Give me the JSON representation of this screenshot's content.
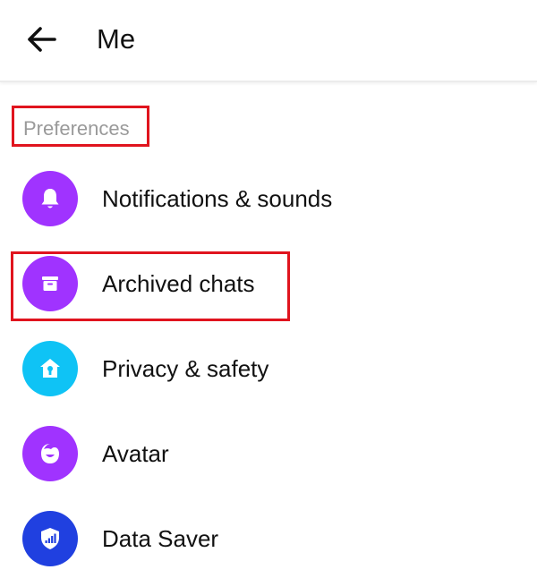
{
  "header": {
    "title": "Me",
    "back_icon": "arrow-left-icon"
  },
  "preferences": {
    "section_label": "Preferences",
    "items": [
      {
        "label": "Notifications & sounds",
        "icon": "bell-icon",
        "color": "#a033ff"
      },
      {
        "label": "Archived chats",
        "icon": "archive-icon",
        "color": "#a033ff"
      },
      {
        "label": "Privacy & safety",
        "icon": "home-lock-icon",
        "color": "#0fc3f5"
      },
      {
        "label": "Avatar",
        "icon": "avatar-face-icon",
        "color": "#a033ff"
      },
      {
        "label": "Data Saver",
        "icon": "shield-signal-icon",
        "color": "#2040e0"
      }
    ]
  },
  "colors": {
    "highlight": "#e0141e",
    "section_label": "#9a9a9a"
  }
}
